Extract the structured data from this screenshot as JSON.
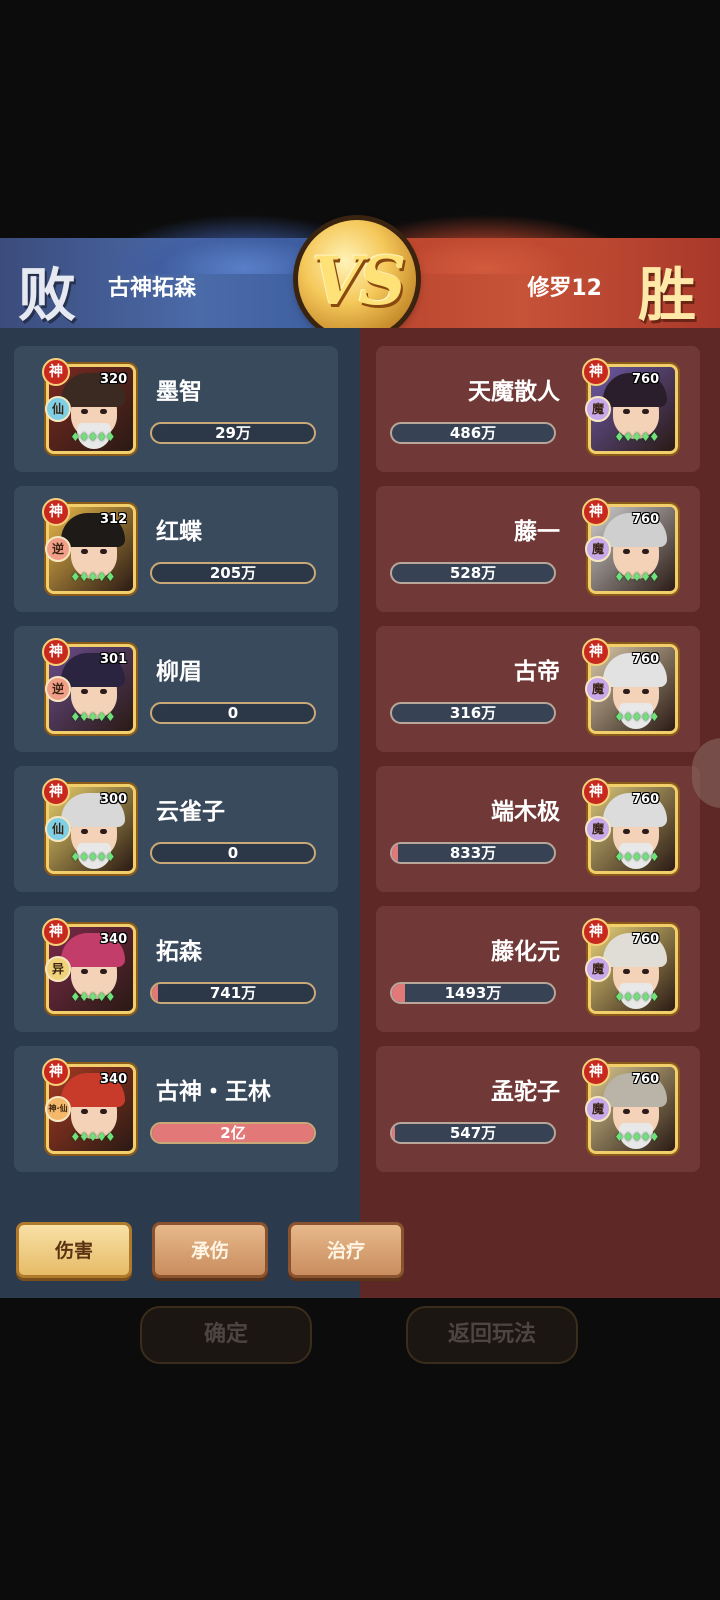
{
  "header": {
    "left_result": "败",
    "left_player": "古神拓森",
    "vs": "VS",
    "right_player": "修罗12",
    "right_result": "胜"
  },
  "left_team": [
    {
      "name": "墨智",
      "level": "320",
      "rank": "神",
      "faction": "仙",
      "value": "29万",
      "fill": 0.0
    },
    {
      "name": "红蝶",
      "level": "312",
      "rank": "神",
      "faction": "逆",
      "value": "205万",
      "fill": 0.0
    },
    {
      "name": "柳眉",
      "level": "301",
      "rank": "神",
      "faction": "逆",
      "value": "0",
      "fill": 0.0
    },
    {
      "name": "云雀子",
      "level": "300",
      "rank": "神",
      "faction": "仙",
      "value": "0",
      "fill": 0.0
    },
    {
      "name": "拓森",
      "level": "340",
      "rank": "神",
      "faction": "异",
      "value": "741万",
      "fill": 0.04
    },
    {
      "name": "古神・王林",
      "level": "340",
      "rank": "神",
      "faction": "神·仙",
      "value": "2亿",
      "fill": 1.0
    }
  ],
  "right_team": [
    {
      "name": "天魔散人",
      "level": "760",
      "rank": "神",
      "faction": "魔",
      "value": "486万",
      "fill": 0.0
    },
    {
      "name": "藤一",
      "level": "760",
      "rank": "神",
      "faction": "魔",
      "value": "528万",
      "fill": 0.0
    },
    {
      "name": "古帝",
      "level": "760",
      "rank": "神",
      "faction": "魔",
      "value": "316万",
      "fill": 0.0
    },
    {
      "name": "端木极",
      "level": "760",
      "rank": "神",
      "faction": "魔",
      "value": "833万",
      "fill": 0.04
    },
    {
      "name": "藤化元",
      "level": "760",
      "rank": "神",
      "faction": "魔",
      "value": "1493万",
      "fill": 0.08
    },
    {
      "name": "孟驼子",
      "level": "760",
      "rank": "神",
      "faction": "魔",
      "value": "547万",
      "fill": 0.02
    }
  ],
  "tabs": [
    "伤害",
    "承伤",
    "治疗"
  ],
  "buttons": {
    "confirm": "确定",
    "back": "返回玩法"
  }
}
